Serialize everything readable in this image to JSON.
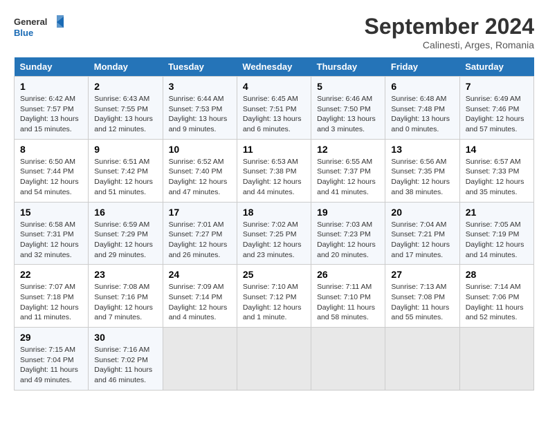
{
  "header": {
    "logo_line1": "General",
    "logo_line2": "Blue",
    "month": "September 2024",
    "location": "Calinesti, Arges, Romania"
  },
  "weekdays": [
    "Sunday",
    "Monday",
    "Tuesday",
    "Wednesday",
    "Thursday",
    "Friday",
    "Saturday"
  ],
  "weeks": [
    [
      {
        "day": "1",
        "info": "Sunrise: 6:42 AM\nSunset: 7:57 PM\nDaylight: 13 hours and 15 minutes."
      },
      {
        "day": "2",
        "info": "Sunrise: 6:43 AM\nSunset: 7:55 PM\nDaylight: 13 hours and 12 minutes."
      },
      {
        "day": "3",
        "info": "Sunrise: 6:44 AM\nSunset: 7:53 PM\nDaylight: 13 hours and 9 minutes."
      },
      {
        "day": "4",
        "info": "Sunrise: 6:45 AM\nSunset: 7:51 PM\nDaylight: 13 hours and 6 minutes."
      },
      {
        "day": "5",
        "info": "Sunrise: 6:46 AM\nSunset: 7:50 PM\nDaylight: 13 hours and 3 minutes."
      },
      {
        "day": "6",
        "info": "Sunrise: 6:48 AM\nSunset: 7:48 PM\nDaylight: 13 hours and 0 minutes."
      },
      {
        "day": "7",
        "info": "Sunrise: 6:49 AM\nSunset: 7:46 PM\nDaylight: 12 hours and 57 minutes."
      }
    ],
    [
      {
        "day": "8",
        "info": "Sunrise: 6:50 AM\nSunset: 7:44 PM\nDaylight: 12 hours and 54 minutes."
      },
      {
        "day": "9",
        "info": "Sunrise: 6:51 AM\nSunset: 7:42 PM\nDaylight: 12 hours and 51 minutes."
      },
      {
        "day": "10",
        "info": "Sunrise: 6:52 AM\nSunset: 7:40 PM\nDaylight: 12 hours and 47 minutes."
      },
      {
        "day": "11",
        "info": "Sunrise: 6:53 AM\nSunset: 7:38 PM\nDaylight: 12 hours and 44 minutes."
      },
      {
        "day": "12",
        "info": "Sunrise: 6:55 AM\nSunset: 7:37 PM\nDaylight: 12 hours and 41 minutes."
      },
      {
        "day": "13",
        "info": "Sunrise: 6:56 AM\nSunset: 7:35 PM\nDaylight: 12 hours and 38 minutes."
      },
      {
        "day": "14",
        "info": "Sunrise: 6:57 AM\nSunset: 7:33 PM\nDaylight: 12 hours and 35 minutes."
      }
    ],
    [
      {
        "day": "15",
        "info": "Sunrise: 6:58 AM\nSunset: 7:31 PM\nDaylight: 12 hours and 32 minutes."
      },
      {
        "day": "16",
        "info": "Sunrise: 6:59 AM\nSunset: 7:29 PM\nDaylight: 12 hours and 29 minutes."
      },
      {
        "day": "17",
        "info": "Sunrise: 7:01 AM\nSunset: 7:27 PM\nDaylight: 12 hours and 26 minutes."
      },
      {
        "day": "18",
        "info": "Sunrise: 7:02 AM\nSunset: 7:25 PM\nDaylight: 12 hours and 23 minutes."
      },
      {
        "day": "19",
        "info": "Sunrise: 7:03 AM\nSunset: 7:23 PM\nDaylight: 12 hours and 20 minutes."
      },
      {
        "day": "20",
        "info": "Sunrise: 7:04 AM\nSunset: 7:21 PM\nDaylight: 12 hours and 17 minutes."
      },
      {
        "day": "21",
        "info": "Sunrise: 7:05 AM\nSunset: 7:19 PM\nDaylight: 12 hours and 14 minutes."
      }
    ],
    [
      {
        "day": "22",
        "info": "Sunrise: 7:07 AM\nSunset: 7:18 PM\nDaylight: 12 hours and 11 minutes."
      },
      {
        "day": "23",
        "info": "Sunrise: 7:08 AM\nSunset: 7:16 PM\nDaylight: 12 hours and 7 minutes."
      },
      {
        "day": "24",
        "info": "Sunrise: 7:09 AM\nSunset: 7:14 PM\nDaylight: 12 hours and 4 minutes."
      },
      {
        "day": "25",
        "info": "Sunrise: 7:10 AM\nSunset: 7:12 PM\nDaylight: 12 hours and 1 minute."
      },
      {
        "day": "26",
        "info": "Sunrise: 7:11 AM\nSunset: 7:10 PM\nDaylight: 11 hours and 58 minutes."
      },
      {
        "day": "27",
        "info": "Sunrise: 7:13 AM\nSunset: 7:08 PM\nDaylight: 11 hours and 55 minutes."
      },
      {
        "day": "28",
        "info": "Sunrise: 7:14 AM\nSunset: 7:06 PM\nDaylight: 11 hours and 52 minutes."
      }
    ],
    [
      {
        "day": "29",
        "info": "Sunrise: 7:15 AM\nSunset: 7:04 PM\nDaylight: 11 hours and 49 minutes."
      },
      {
        "day": "30",
        "info": "Sunrise: 7:16 AM\nSunset: 7:02 PM\nDaylight: 11 hours and 46 minutes."
      },
      {
        "day": "",
        "info": ""
      },
      {
        "day": "",
        "info": ""
      },
      {
        "day": "",
        "info": ""
      },
      {
        "day": "",
        "info": ""
      },
      {
        "day": "",
        "info": ""
      }
    ]
  ]
}
